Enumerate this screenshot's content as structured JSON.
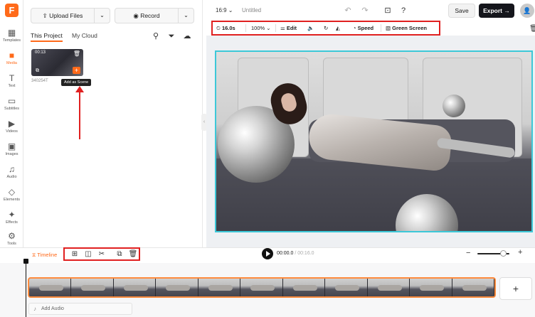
{
  "app": {
    "logo_letter": "F",
    "accent_color": "#ff6a1a",
    "highlight_color": "#e02020"
  },
  "rail": {
    "items": [
      {
        "label": "Templates",
        "icon": "templates-icon"
      },
      {
        "label": "Media",
        "icon": "media-icon",
        "active": true
      },
      {
        "label": "Text",
        "icon": "text-icon"
      },
      {
        "label": "Subtitles",
        "icon": "subtitles-icon"
      },
      {
        "label": "Videos",
        "icon": "videos-icon"
      },
      {
        "label": "Images",
        "icon": "images-icon"
      },
      {
        "label": "Audio",
        "icon": "audio-icon"
      },
      {
        "label": "Elements",
        "icon": "elements-icon"
      },
      {
        "label": "Effects",
        "icon": "effects-icon"
      },
      {
        "label": "Tools",
        "icon": "tools-icon"
      }
    ]
  },
  "panel": {
    "upload_label": "Upload Files",
    "record_label": "Record",
    "tabs": [
      "This Project",
      "My Cloud"
    ],
    "media": {
      "duration": "00:13",
      "name": "340254T",
      "tooltip": "Add as Scene"
    }
  },
  "topbar": {
    "ratio": "16:9",
    "title": "Untitled",
    "save_label": "Save",
    "export_label": "Export"
  },
  "toolbar": {
    "duration": "16.0s",
    "zoom": "100%",
    "edit_label": "Edit",
    "speed_label": "Speed",
    "green_screen_label": "Green Screen"
  },
  "timeline": {
    "label": "Timeline",
    "current_time": "00:00.0",
    "total_time": "00:16.0",
    "zoom_level": 0.8,
    "add_audio_label": "Add Audio",
    "frame_count": 11
  }
}
